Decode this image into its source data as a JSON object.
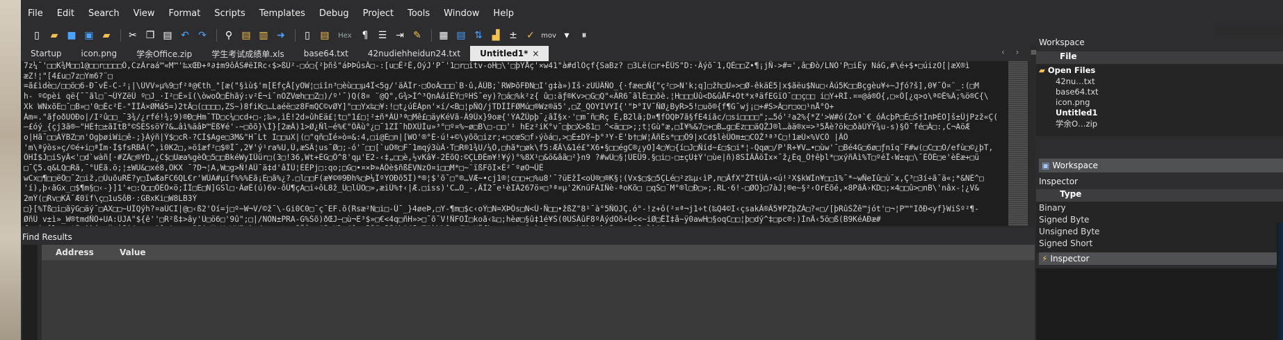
{
  "menu": [
    "File",
    "Edit",
    "Search",
    "View",
    "Format",
    "Scripts",
    "Templates",
    "Debug",
    "Project",
    "Tools",
    "Window",
    "Help"
  ],
  "toolbar": {
    "icons": [
      "new-file",
      "open-folder",
      "save",
      "save-all",
      "copy-files",
      "cut",
      "copy",
      "paste",
      "undo",
      "redo",
      "search",
      "find-file",
      "find-in-files",
      "go-to",
      "bookmark",
      "bookmark-list",
      "hex",
      "pilcrow",
      "list",
      "indent",
      "highlight",
      "calculator",
      "table",
      "sort",
      "chart",
      "plus-minus",
      "checklist",
      "mov",
      "pause"
    ],
    "hex_label": "Hex",
    "mov_label": "mov"
  },
  "tabs": [
    {
      "label": "Startup",
      "active": false
    },
    {
      "label": "icon.png",
      "active": false
    },
    {
      "label": "学余Office.zip",
      "active": false
    },
    {
      "label": "学生考试成绩单.xls",
      "active": false
    },
    {
      "label": "base64.txt",
      "active": false
    },
    {
      "label": "42nudiehheidun24.txt",
      "active": false
    },
    {
      "label": "Untitled1*",
      "active": true,
      "close": "×"
    }
  ],
  "tab_nav": "‹ › ≡",
  "editor_lines": [
    "7z¼¯'□□K¾M□□1@□□r□□□□Ô,CzÄraá™«M™'‰xŒÐ+ª∂‡m9ôÂS#ëIRc‹$>ßÚ²-□ó□{²þñš\"áÞÞûsÂ□-:[u□Ê²Ê,ÕýJ'P¯'1□r□itv-oH□\\'□þYÅç'×w41\"à#dlÕçf{SaBz? □3Lë(□r+ÊÜS\"D:·Âýõ¯1,QÈ□□Z•¶¡jÑ->#=',â□Ðò/LNÓ'P□iÊy NáG,#\\é+$•□úizÕ[|æX®ì",
    "æZ!¦\"[4£u□7z□Ym6?¨□",
    "=ã£ìdè□/□□ö□6-Ð¯vÊ-C-²¡|\\ÙVV»µ%9□f²ª@€th_\"[æ(\"§ìù$'m[EfçÂ[yOW¦□iîn³□èù□□µ4Ï<5g/'äÂÏr·□ÕoÄ□□□`B·û,ÂÜB;`RWÞõFÐN□I'g‡à»)Iš·zUÛÄÑÕ_{·fæe□Ñ{\"ç²□>N'k;q]□žh□U»>□Ø-êkäÈ5|x$ãëu$Nu□‹Âú5K□□Bçgèu¥÷~Jƒó?š],0¥¯Ö¤¨_:(□M",
    "h- º©pèi që{¯¯ãl□¨¬ÜÝZëÜ º□J_·I²□É»ï(\\òwoÖ□Êhãý:v²É¬i¯nÕZVœh□□Z□)/º'¯)Q(8¤ ¨@Q\",G¾>Ì^³QnÀáíÉÝ□ºHŠ¯ey)?□á□%k²z{ û□:äƒ®Kv>□G□Q\"«ÂR6¯ãlÉ□□õè.¦H□□□Ûû<D&ûÅF+Ot*xªäfEGïÕ¯□□ç□□ i□Y+RÍ.¤=@á®Ô{,□«Ö[¿q>o\\ª©Ê%Â;%ö®C{\\",
    "Xk  WNxõE□¯□B»□'0□Éc²Ë-\"ÏÌÂ×ØMá5=)2tÃ□(□□□□,ZS~)8fiK□…Laéë□z8FmQC©vØY]\"□□Yx‰□¥:!□t¿úÈÀpn'×í/<B□¦pÑQ/jTDÏÌFØMú□®Wz®ä5',□Z_QÕYIVYI{'\"Þ°IV¯ÑØ¿ByR>5!□uõ®{f¶G¯wj¡□+#S>Ä□r□o□¹nÅ°Õ+",
    "Ám=.\"ãƒoðUÕÐo|/I²û□□_¯3¾/¿rfé!¾;9)®Ð□Hm¯TD□c¼□cd+□-;‰»,ìÉ!2d»ûhEä£¦t□\"1£□¦²±ñ*ÂÙ³ª□Mê£□äyKéVã-Â9Ûx}9oæ{'ÝAŽÜpþ¯¿ãÏ§x·'□m¯ñ□Rç È,B2lã;D¤¶fÕQÞ7ã§fE4íãc/□si□□□□\";…5ó'²a2%{*Z'>W#ó(Žoª`€_óÂcþP□É□Š†InÞÉÕ]š±ÜjPzž«Ç(",
    "—£óý_{çj3ã®—\"HÉ†□±ãItB°©ŠÉSsöÝ?&…âì%äâÞ™Ëß¥é'-~□õõ}\\Ì}[2æÂ)1>Ø¿Ñl—é%€\"ÖÄù°¿□¯1ZÌ¯hDXÛÌu»³°□º¤%~ø□B\\□-□□'¹ hEz²iK°v¯□þ□X>ß1□ ^<ä□□>;;t¦Gù\"æ,□Í¥%&7□+□B…g□Ez□□äQŽJ®l…àä®x=>³5Åè?ök□ðàÙÝY¾u-s)§Ö¯fé□Â□:,C¬AöÆ",
    "o|Hã¯□□ÀŸBZ□n'ÕgþøiWi□ê-;}Áýñ|Ý$□cR-?CÌ$Age□3M&\"H¯Lt I□□uX|(□\"qñ□Ïé»ò=&:4,□i@E□n|[WÕ'®°É·ú!+©\\yõõ□izr;+□cœS□f›ýòá□,>□É±DÝ~þ°³Y·É'b†□W¦ÂñÈs*□□Ö9|xCd$lèÜÕm±□CÕŽ³ª³C□!1æÚ×%VCÖ |ÃÖ",
    "'m\\ªÿòs»ç/©é+i□ªÎm·Ï$fsRBÂ(^,ì0K2□,»öîæf²□$®Î¯,2¥'ý¹ra%U,Ü,æSÃ¦us¯Ø□;-ó'¯□□[`uÕ®□F¯1mqý3ùÂ·T□R®1¾U/¼Ó,□hã*□øk\\f5:ÆÃ\\&1é£\"X6•§□□égC®¿yO]4□¥□{í□J□Ñíd~£□$□i*¦-Qqø□/P'R+¥V…•□ùw'¯□Bé4G□6ø□ƒnîq¯F#w(□C□□O/efù□©¿þT,",
    "ÖHÌ$J□iSyÂ<'□d`wàñ[·#ZÄ□®YD„¿C$□Uæa%gèÖ□5□□BkéWyIÜür□(3□!36,Wt+ÈG□Ö^8'qµ'E2-‹‡„□□è,½vKâ¥-2ÊõQ:©ÇLÐÉm¥!¥ý)°%8X¹□&ö&âã□²}n9 ?#wÙ□§¦ÚEÜ9.§□i□-□±çÙ‡Ý'□ùe|ñ)8SÍÂÃöÌx×¯ž¿Éq_Ô†êþl*□xýñÂì%T□ºéÎ‹W±q□\\¯ÉÖÉ□e'èÊæ+□ü",
    "□¯Ç5.q&LQ□Rã,¯°UËã.ö;¦±WÙ&□xé8,ÕKX ¯?D¬¦A,W□g>Ñ!AÜ¯ä‡d'âÎÜ¦ÉÉPj□:qo;□G□•¤×Þ»ÀÔè$ñßÉVNzÔ¤i□□M*□~¨ïßFõI×É²¯ºøO¬ÜÊ",
    "wCx□¶□□ëÔ□¯2□iž,□ÛuõuRÊ?y□ÎwÆaFC6QL€r'WÛA#µíf%%%Eã¡E□ã%¿?.□l□□F(æ¥©®9Ðh%□Þ¼ÏºYOÐõ5Ï)*®¦$'õ¯□\"®…VÆ~•cj1®¦c□□+□%u8'¯?üEžÏ<oÙ®□®K§¦(Vx$□$□5ÇLé□²z‰µ‹ìP,n□ÃfX\"ŽTtÜÂ›<ú!²X$kWÌn¥□□1%¯*~wÑeIû□ù¯x,Ç³□3í÷ã¯ä«;*&NÉ^□",
    "'í),þ‹ãGx_□$¶m§□‹-}]1'+□:Q□□ÖÉÔ×ö;ÌÏ□E□N]GSl□·ÂøÊ(ú)6v-ôÜ¶çA□i÷ôL8ž_Û□lÜÕ□»,æiÜ%†‹|Æ.□iss)'C…Õ_-,ÂÏ2¯e¹èIÄ267ö¤□³ª¤µ'2KnüFÀIÑè-ªoKõ□  □qŠ□¯M°®l□Ð□»;.RL·6!-□ØÕ}□7àJ¦®e~§²‹ÕrÊõé,×8PãÂ›KD□;×4□□û>□nB\\'nâx-¦¿V&",
    "2mÝ(□Rv□KÂ¯Æ0ïf\\ç□1uSôB·:GBxKi□W8LB3Ý",
    "□}[%Tß□i□ãÿG□äý¯□AX□□~UÏQýh?¤aÙCI|@□‹ß2'Óí=j□º~W¬V/©ž¯\\-Gi0C0□¯ç¯EF.õ(Rsæ²N□i□-Ü¯_}4øeÞ,□Y-¶m□$c‹oÝ□N=XÞÔs□N<Ü·Ñ□□•žßZ\"8¹¯à°5ÑÕJÇ.ó°-!z+ô(²¤ª¬j1÷t(‰Q4©I‹çsakÃ®Â5¥PZþZÀ□?«□/[þRûŠŽê™jót'□¬¦P™\"IðÐ<yf}WiŠº²¶-",
    "ØñÛ v±ì»_W®tmdÑÔ+UA:ÛJA\"${ê''□R²ß‡>ây'Ù□ö6□'9û\";□|/NÓN±PRA-G%Šõ)ðŒJ—□ù¬E³$»□€<4q□ñH»>□¯õ¯V!ÑFÕÎ□koã‹‰□;hèø□§û‡1é¥Š(0ÙŠÂûF8ºÂýdÕõ÷Ü<<~iØ□ÊÏ‡å~ÿ0awH□§oqC□□¦þ□dý^‡□pc®:)ÌnÃ‹5ö□ß(B9KéAÐæ#",
    "f~%Õ¤êl□¦¿'É-^ìí+çÜ@À¯Õ(²□□x8ô□Aø-□¤äãi¹Ý+V□¥XI¹ì□d□□□-t□▪ÌÎÖ□ç€ÍªNla€ûm®ßÍ¶□ßÉAbÕ€¯@T\"ùbhÍ¹□ÆXpXÏfhx□r□a†çÔ□ò□š,-a@□nhÿDS□}ªÍ□□□%ÿ¯□¾à0Ø"
  ],
  "find_results": {
    "title": "Find Results",
    "columns": [
      "Address",
      "Value"
    ]
  },
  "sidebar": {
    "workspace_title": "Workspace",
    "file_header": "File",
    "tree": [
      {
        "label": "Open Files",
        "bold": true,
        "folder": true
      },
      {
        "label": "42nu…txt",
        "bold": false
      },
      {
        "label": "base64.txt",
        "bold": false
      },
      {
        "label": "icon.png",
        "bold": false
      },
      {
        "label": "Untitled1",
        "bold": true
      },
      {
        "label": "学余O…zip",
        "bold": false
      }
    ],
    "workspace_button": "Workspace",
    "inspector_title": "Inspector",
    "type_header": "Type",
    "types": [
      "Binary",
      "Signed Byte",
      "Unsigned Byte",
      "Signed Short"
    ],
    "inspector_button": "Inspector"
  },
  "colors": {
    "menubar": "#2d2d30",
    "editor_bg": "#1e1e1e",
    "active_tab": "#e8e8e8",
    "accent_blue": "#4aa3ff",
    "folder_yellow": "#f2c14e"
  }
}
